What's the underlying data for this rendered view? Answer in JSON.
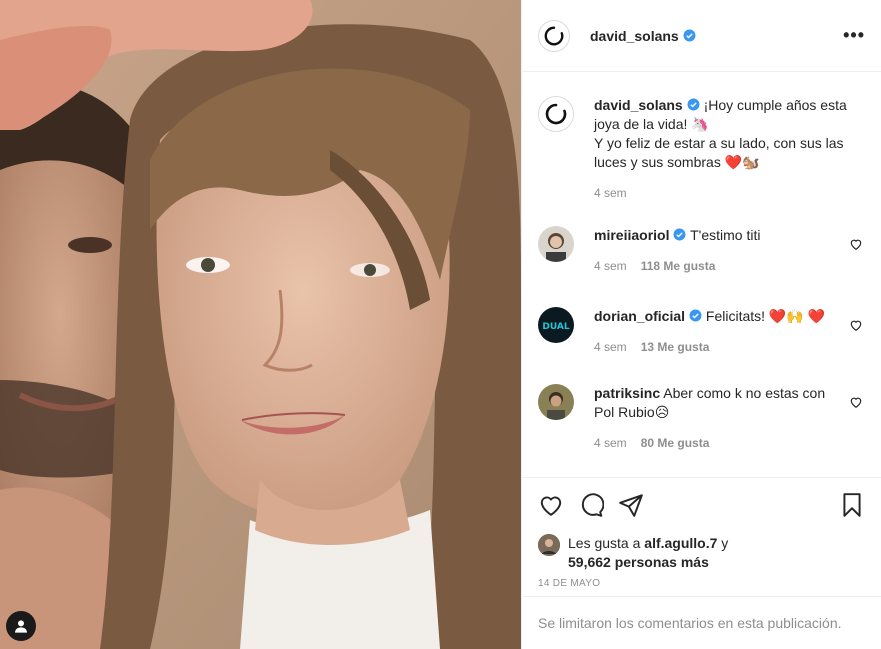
{
  "post": {
    "author": "david_solans",
    "verified": true
  },
  "caption": {
    "username": "david_solans",
    "line1": "¡Hoy cumple años esta joya de la vida! 🦄",
    "line2": "Y yo feliz de estar a su lado, con sus las luces y sus sombras ❤️🐿️",
    "time": "4 sem"
  },
  "comments": [
    {
      "username": "mireiiaoriol",
      "verified": true,
      "text": "T'estimo titi",
      "time": "4 sem",
      "likes": "118 Me gusta"
    },
    {
      "username": "dorian_oficial",
      "verified": true,
      "text": "Felicitats! ❤️🙌 ❤️",
      "time": "4 sem",
      "likes": "13 Me gusta"
    },
    {
      "username": "patriksinc",
      "verified": false,
      "text": "Aber como k no estas con Pol Rubio😥",
      "time": "4 sem",
      "likes": "80 Me gusta"
    }
  ],
  "likes": {
    "prefix": "Les gusta a ",
    "first_user": "alf.agullo.7",
    "conj": " y",
    "others": "59,662 personas más"
  },
  "date": "14 DE MAYO",
  "comments_limited": "Se limitaron los comentarios en esta publicación.",
  "colors": {
    "verified": "#3897f0",
    "heart": "#ed4956",
    "meta": "#8e8e8e"
  },
  "icons": [
    "heart-icon",
    "comment-icon",
    "share-icon",
    "bookmark-icon",
    "more-icon",
    "user-tag-icon"
  ]
}
